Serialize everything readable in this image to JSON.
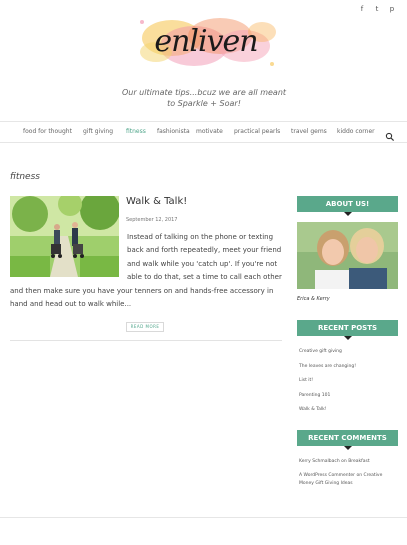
{
  "social": {
    "facebook": "f",
    "twitter": "t",
    "pinterest": "p"
  },
  "header": {
    "logo_text": "enliven",
    "tagline": "Our ultimate tips...bcuz we are all meant to Sparkle + Soar!"
  },
  "nav": {
    "items": [
      {
        "label": "food for thought"
      },
      {
        "label": "gift giving"
      },
      {
        "label": "fitness"
      },
      {
        "label": "fashionista"
      },
      {
        "label": "motivate"
      },
      {
        "label": "practical pearls"
      },
      {
        "label": "travel gems"
      },
      {
        "label": "kiddo corner"
      }
    ],
    "active": "fitness",
    "search_icon": "search-icon"
  },
  "category": {
    "title": "fitness"
  },
  "post": {
    "title": "Walk & Talk!",
    "date": "September 12, 2017",
    "excerpt": "Instead of talking on the phone or texting back and forth repeatedly, meet your friend and walk while you 'catch up'. If you're not able to do that, set a time to call each other and then make sure you have your tenners on and hands-free accessory in hand and head out to walk while...",
    "read_more": "READ MORE"
  },
  "sidebar": {
    "about": {
      "heading": "ABOUT US!",
      "caption": "Erica & Kerry"
    },
    "recent_posts": {
      "heading": "RECENT POSTS",
      "items": [
        {
          "label": "Creative gift giving"
        },
        {
          "label": "The leaves are changing!"
        },
        {
          "label": "List it!"
        },
        {
          "label": "Parenting 101"
        },
        {
          "label": "Walk & Talk!"
        }
      ]
    },
    "recent_comments": {
      "heading": "RECENT COMMENTS",
      "items": [
        {
          "label": "Kerry Schmalbach on Breakfast"
        },
        {
          "label": "A WordPress Commenter on Creative Money Gift Giving Ideas"
        }
      ]
    }
  },
  "colors": {
    "accent": "#5aa88b",
    "link_active": "#4fa58a"
  }
}
